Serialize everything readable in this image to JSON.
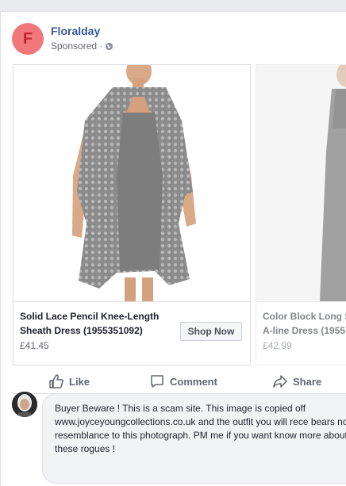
{
  "post": {
    "avatar_letter": "F",
    "page_name": "Floralday",
    "sponsored_label": "Sponsored ·"
  },
  "products": [
    {
      "title": "Solid Lace Pencil Knee-Length Sheath Dress (1955351092)",
      "price": "£41.45",
      "button": "Shop Now",
      "image": "grey-lace-dress-photo"
    },
    {
      "title": "Color Block Long S",
      "title2": "A-line Dress (1955",
      "price": "£42.99",
      "image": "grey-dress-photo"
    }
  ],
  "actions": {
    "like": "Like",
    "comment": "Comment",
    "share": "Share"
  },
  "comment": {
    "text": "Buyer Beware ! This is a scam site. This image is copied off www.joyceyoungcollections.co.uk and the outfit you will rece bears no resemblance to this photograph. PM me if you want know more about these rogues !"
  }
}
